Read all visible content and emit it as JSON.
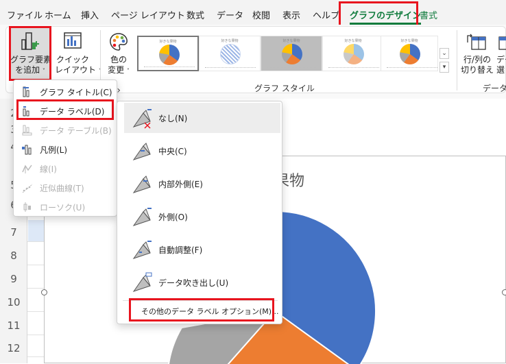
{
  "ribbon_tabs": [
    {
      "label": "ファイル"
    },
    {
      "label": "ホーム"
    },
    {
      "label": "挿入"
    },
    {
      "label": "ページ レイアウト"
    },
    {
      "label": "数式"
    },
    {
      "label": "データ"
    },
    {
      "label": "校閲"
    },
    {
      "label": "表示"
    },
    {
      "label": "ヘルプ"
    },
    {
      "label": "グラフのデザイン"
    },
    {
      "label": "書式"
    }
  ],
  "ribbon": {
    "add_element": {
      "line1": "グラフ要素",
      "line2": "を追加"
    },
    "quick_layout": {
      "line1": "クイック",
      "line2": "レイアウト"
    },
    "change_colors": {
      "line1": "色の",
      "line2": "変更"
    },
    "chart_styles_group": "グラフ スタイル",
    "switch_row_col": {
      "line1": "行/列の",
      "line2": "切り替え"
    },
    "select_data": {
      "line1": "デー",
      "line2": "選"
    },
    "data_group": "データ",
    "style_thumb_title": "好きな果物"
  },
  "colors": {
    "blue": "#4472c4",
    "orange": "#ed7d31",
    "gray": "#a5a5a5",
    "yellow": "#ffc000",
    "light_blue": "#5b9bd5",
    "green": "#70ad47",
    "highlight_red": "#e8141e",
    "active_tab_green": "#0f7b3c"
  },
  "menu": {
    "items": [
      {
        "label": "グラフ タイトル(C)",
        "enabled": true,
        "icon": "chart-title-icon"
      },
      {
        "label": "データ ラベル(D)",
        "enabled": true,
        "icon": "data-labels-icon"
      },
      {
        "label": "データ テーブル(B)",
        "enabled": false,
        "icon": "data-table-icon"
      },
      {
        "label": "凡例(L)",
        "enabled": true,
        "icon": "legend-icon"
      },
      {
        "label": "線(I)",
        "enabled": false,
        "icon": "lines-icon"
      },
      {
        "label": "近似曲線(T)",
        "enabled": false,
        "icon": "trendline-icon"
      },
      {
        "label": "ローソク(U)",
        "enabled": false,
        "icon": "candlestick-icon"
      }
    ]
  },
  "submenu": {
    "items": [
      {
        "label": "なし(N)",
        "icon": "label-none-icon"
      },
      {
        "label": "中央(C)",
        "icon": "label-center-icon"
      },
      {
        "label": "内部外側(E)",
        "icon": "label-inside-end-icon"
      },
      {
        "label": "外側(O)",
        "icon": "label-outside-end-icon"
      },
      {
        "label": "自動調整(F)",
        "icon": "label-best-fit-icon"
      },
      {
        "label": "データ吹き出し(U)",
        "icon": "label-callout-icon"
      }
    ],
    "more_options": "その他のデータ ラベル オプション(M)..."
  },
  "sheet": {
    "row_numbers": [
      "2",
      "3",
      "4",
      "5",
      "6",
      "7",
      "8",
      "9",
      "10",
      "11",
      "12"
    ],
    "chart_title": "果物"
  }
}
